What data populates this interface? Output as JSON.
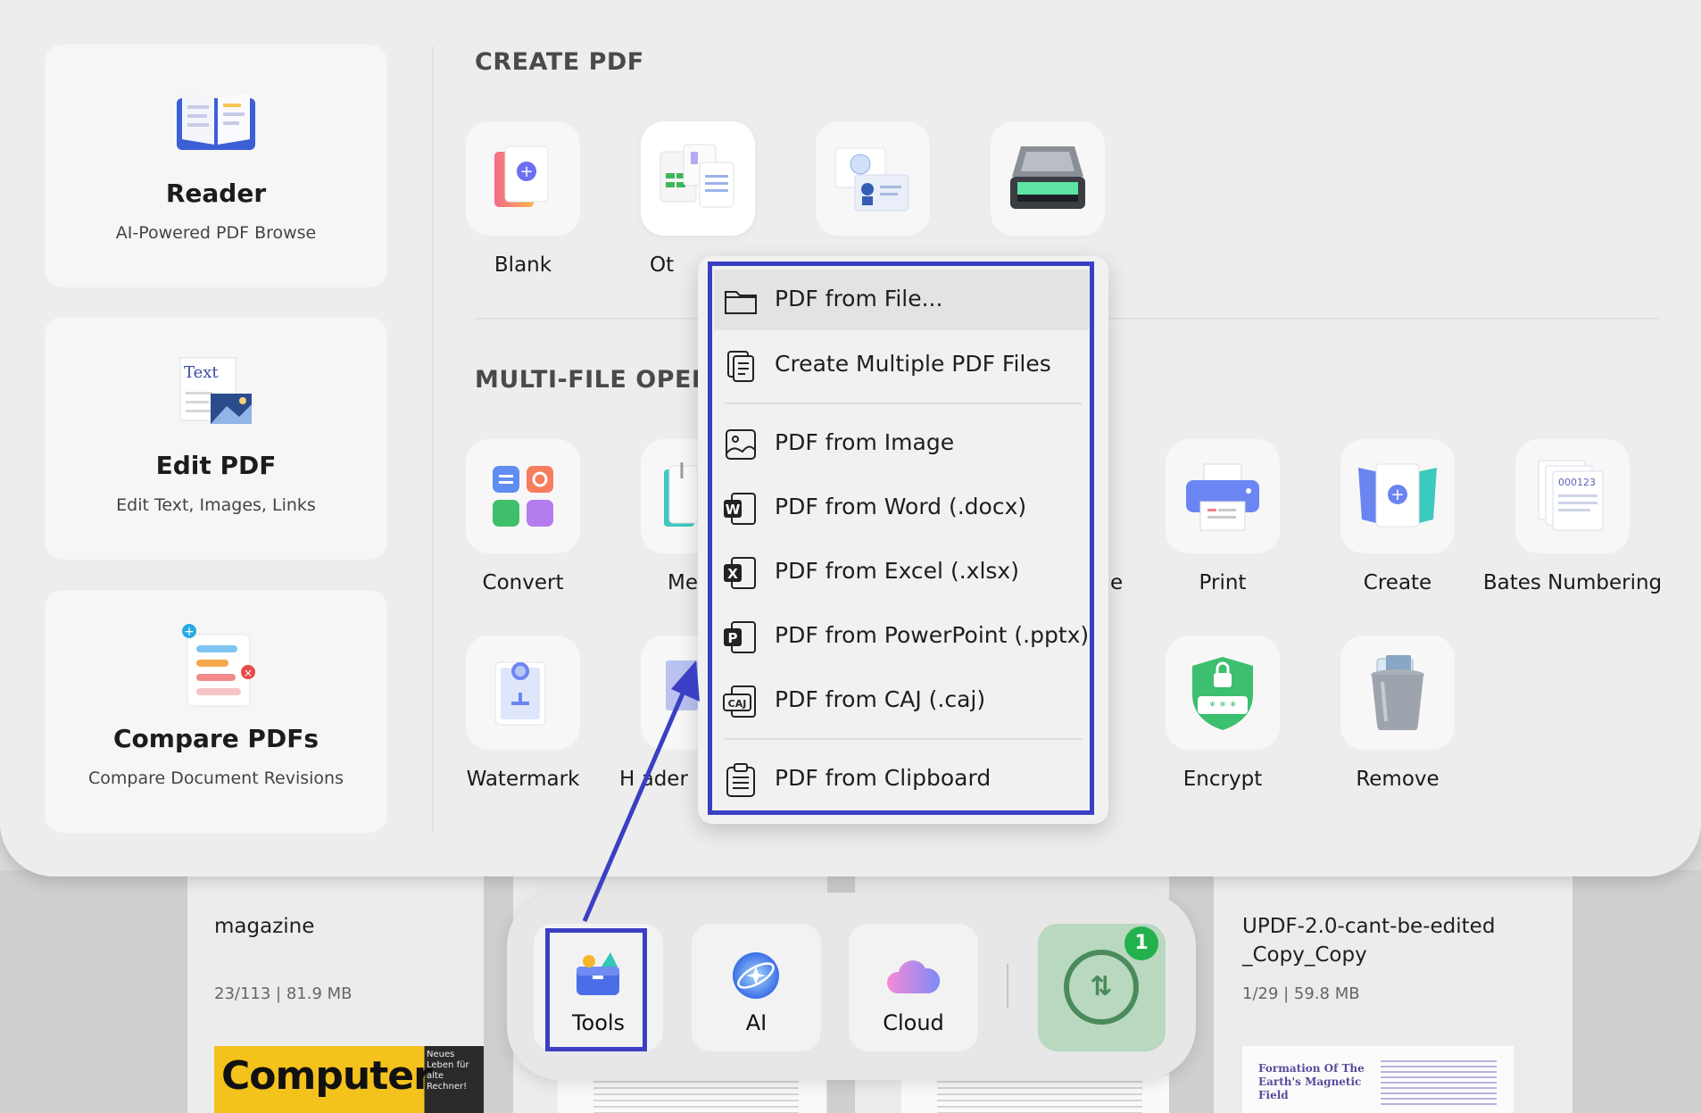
{
  "background": {
    "files": [
      {
        "title": "magazine",
        "meta": "23/113 | 81.9 MB",
        "thumb_word": "Computer",
        "thumb_side": "Neues Leben für alte Rechner!"
      },
      {
        "title": "UPDF-2.0-cant-be-edited",
        "title_line2": "_Copy_Copy",
        "meta": "1/29 | 59.8 MB",
        "thumb_title": "Formation Of The Earth's Magnetic Field"
      }
    ]
  },
  "dock": {
    "tools_label": "Tools",
    "ai_label": "AI",
    "cloud_label": "Cloud",
    "sync_badge": "1"
  },
  "sidebar": {
    "reader": {
      "title": "Reader",
      "subtitle": "AI-Powered PDF Browse"
    },
    "edit": {
      "title": "Edit PDF",
      "subtitle": "Edit Text, Images, Links",
      "icon_text": "Text"
    },
    "compare": {
      "title": "Compare PDFs",
      "subtitle": "Compare Document Revisions"
    }
  },
  "create_pdf": {
    "section_title": "CREATE PDF",
    "tiles": [
      {
        "label": "Blank"
      },
      {
        "label": "Ot"
      }
    ]
  },
  "multi_file": {
    "section_title": "MULTI-FILE OPERAT",
    "tiles_row1": [
      {
        "label": "Convert"
      },
      {
        "label": "Me"
      },
      {
        "label": "e"
      },
      {
        "label": "Print"
      },
      {
        "label": "Create"
      },
      {
        "label": "Bates Numbering"
      }
    ],
    "tiles_row2": [
      {
        "label": "Watermark"
      },
      {
        "label": "H ader"
      },
      {
        "label": "Encrypt"
      },
      {
        "label": "Remove"
      }
    ]
  },
  "menu": {
    "items": [
      {
        "label": "PDF from File..."
      },
      {
        "label": "Create Multiple PDF Files"
      },
      {
        "label": "PDF from Image"
      },
      {
        "label": "PDF from Word (.docx)",
        "glyph": "W"
      },
      {
        "label": "PDF from Excel (.xlsx)",
        "glyph": "X"
      },
      {
        "label": "PDF from PowerPoint (.pptx)",
        "glyph": "P"
      },
      {
        "label": "PDF from CAJ (.caj)",
        "glyph": "CAJ"
      },
      {
        "label": "PDF from Clipboard"
      }
    ]
  },
  "colors": {
    "highlight": "#3a3fc4",
    "badge": "#22b14c",
    "sync": "#4b8a5a"
  }
}
